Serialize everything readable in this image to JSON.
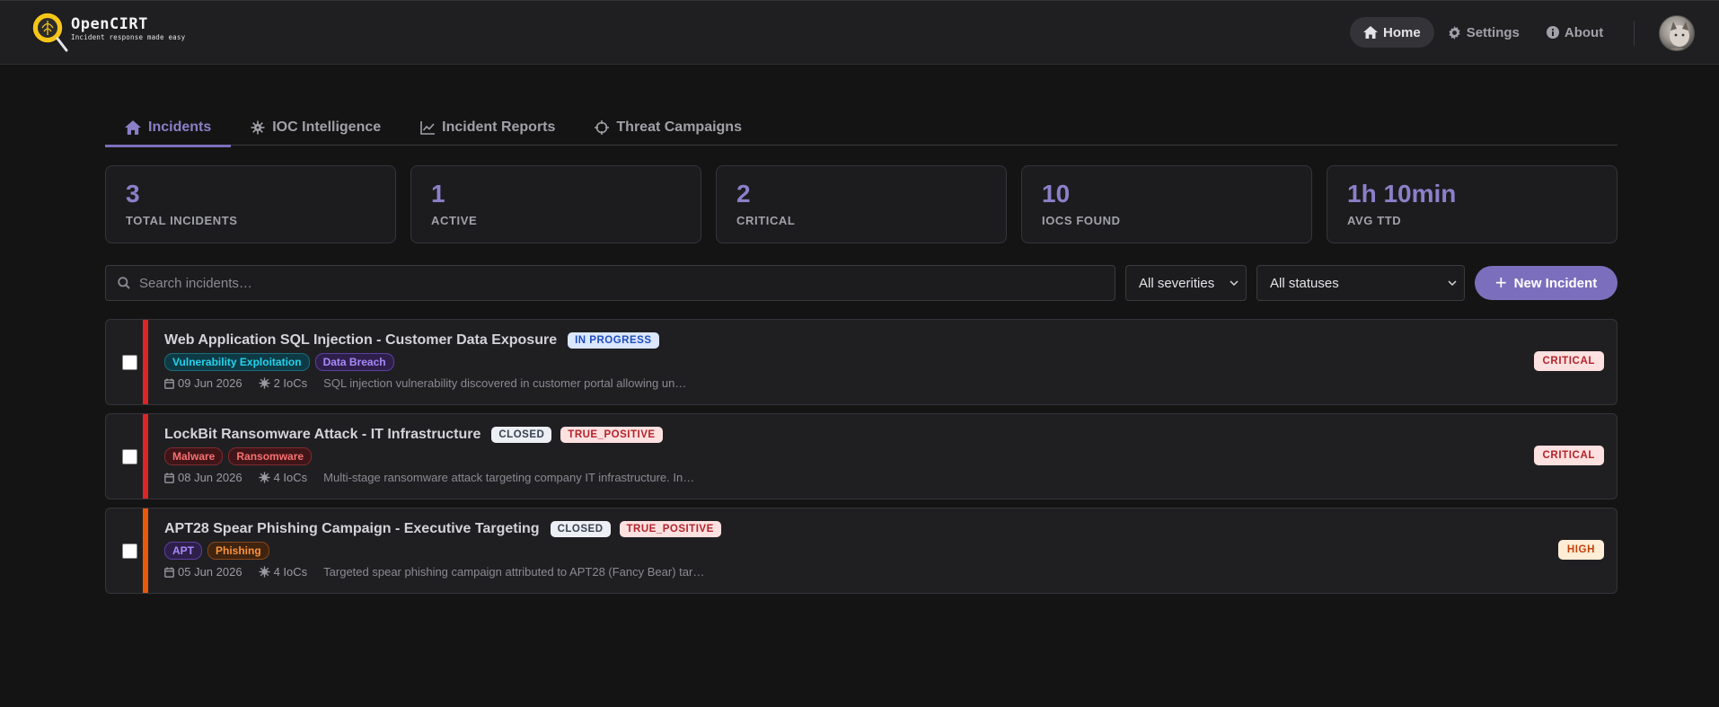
{
  "brand": {
    "name": "OpenCIRT",
    "tagline": "Incident response made easy"
  },
  "nav": {
    "items": [
      {
        "label": "Home",
        "icon": "home-icon",
        "active": true
      },
      {
        "label": "Settings",
        "icon": "gear-icon",
        "active": false
      },
      {
        "label": "About",
        "icon": "info-icon",
        "active": false
      }
    ]
  },
  "tabs": [
    {
      "label": "Incidents",
      "icon": "home-icon",
      "active": true
    },
    {
      "label": "IOC Intelligence",
      "icon": "virus-icon",
      "active": false
    },
    {
      "label": "Incident Reports",
      "icon": "chart-line-icon",
      "active": false
    },
    {
      "label": "Threat Campaigns",
      "icon": "crosshair-icon",
      "active": false
    }
  ],
  "stats": [
    {
      "value": "3",
      "label": "TOTAL INCIDENTS"
    },
    {
      "value": "1",
      "label": "ACTIVE"
    },
    {
      "value": "2",
      "label": "CRITICAL"
    },
    {
      "value": "10",
      "label": "IOCS FOUND"
    },
    {
      "value": "1h 10min",
      "label": "AVG TTD"
    }
  ],
  "filters": {
    "search_placeholder": "Search incidents…",
    "severity_value": "All severities",
    "status_value": "All statuses",
    "new_incident_label": "New Incident"
  },
  "colors": {
    "accent": "#7b6fbd",
    "critical": "#dc2626",
    "high": "#ea580c"
  },
  "incidents": [
    {
      "title": "Web Application SQL Injection - Customer Data Exposure",
      "status": "IN PROGRESS",
      "verdict": "",
      "tags": [
        "Vulnerability Exploitation",
        "Data Breach"
      ],
      "date": "09 Jun 2026",
      "iocs": "2 IoCs",
      "description": "SQL injection vulnerability discovered in customer portal allowing un…",
      "severity": "CRITICAL"
    },
    {
      "title": "LockBit Ransomware Attack - IT Infrastructure",
      "status": "CLOSED",
      "verdict": "TRUE_POSITIVE",
      "tags": [
        "Malware",
        "Ransomware"
      ],
      "date": "08 Jun 2026",
      "iocs": "4 IoCs",
      "description": "Multi-stage ransomware attack targeting company IT infrastructure. In…",
      "severity": "CRITICAL"
    },
    {
      "title": "APT28 Spear Phishing Campaign - Executive Targeting",
      "status": "CLOSED",
      "verdict": "TRUE_POSITIVE",
      "tags": [
        "APT",
        "Phishing"
      ],
      "date": "05 Jun 2026",
      "iocs": "4 IoCs",
      "description": "Targeted spear phishing campaign attributed to APT28 (Fancy Bear) tar…",
      "severity": "HIGH"
    }
  ]
}
